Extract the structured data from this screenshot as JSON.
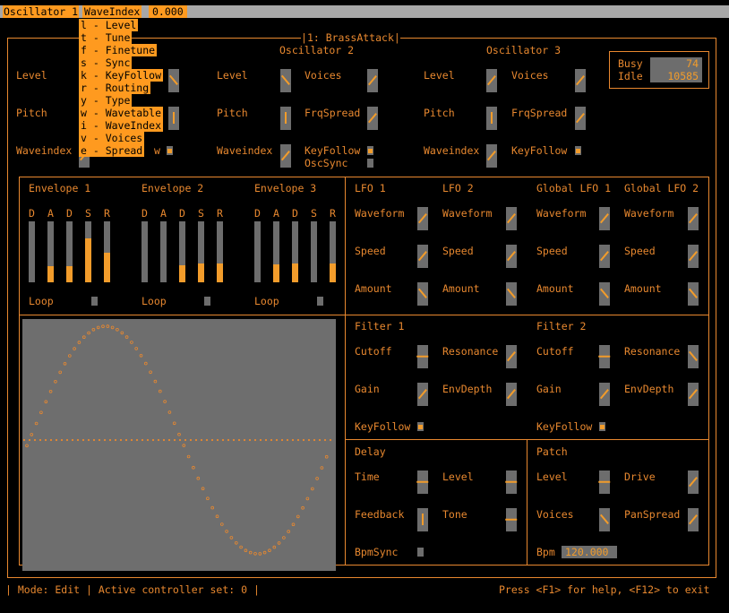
{
  "titlebar": {
    "left": "Oscillator 1",
    "active": "WaveIndex",
    "value": "0.000"
  },
  "menu": {
    "items": [
      "l - Level",
      "t - Tune",
      "f - Finetune",
      "s - Sync",
      "k - KeyFollow",
      "r - Routing",
      "y - Type",
      "w - Wavetable",
      "i - WaveIndex",
      "v - Voices",
      "e - Spread"
    ]
  },
  "patch_title": "1: BrassAttack",
  "status": {
    "busy_label": "Busy",
    "busy_value": "74",
    "idle_label": "Idle",
    "idle_value": "10585"
  },
  "osc2": {
    "title": "Oscillator 2",
    "level": "Level",
    "voices": "Voices",
    "pitch": "Pitch",
    "frqspread": "FrqSpread",
    "waveindex": "Waveindex",
    "keyfollow": "KeyFollow",
    "oscsync": "OscSync"
  },
  "osc3": {
    "title": "Oscillator 3",
    "level": "Level",
    "voices": "Voices",
    "pitch": "Pitch",
    "frqspread": "FrqSpread",
    "waveindex": "Waveindex",
    "keyfollow": "KeyFollow"
  },
  "osc1": {
    "level": "Level",
    "pitch": "Pitch",
    "waveindex": "Waveindex",
    "w_fragment": "w"
  },
  "envelopes": {
    "stages": [
      "D",
      "A",
      "D",
      "S",
      "R"
    ],
    "env1": {
      "title": "Envelope 1",
      "levels": [
        0,
        0.26,
        0.26,
        0.72,
        0.48
      ]
    },
    "env2": {
      "title": "Envelope 2",
      "levels": [
        0,
        0,
        0.28,
        0.31,
        0.31
      ]
    },
    "env3": {
      "title": "Envelope 3",
      "levels": [
        0,
        0.29,
        0.31,
        0,
        0.31
      ]
    },
    "loop": "Loop"
  },
  "lfos": {
    "lfo1": "LFO 1",
    "lfo2": "LFO 2",
    "glfo1": "Global LFO 1",
    "glfo2": "Global LFO 2",
    "waveform": "Waveform",
    "speed": "Speed",
    "amount": "Amount"
  },
  "filters": {
    "f1": "Filter 1",
    "f2": "Filter 2",
    "cutoff": "Cutoff",
    "resonance": "Resonance",
    "gain": "Gain",
    "envdepth": "EnvDepth",
    "keyfollow": "KeyFollow"
  },
  "delay": {
    "title": "Delay",
    "time": "Time",
    "level": "Level",
    "feedback": "Feedback",
    "tone": "Tone",
    "bpmsync": "BpmSync"
  },
  "patch": {
    "title": "Patch",
    "level": "Level",
    "drive": "Drive",
    "voices": "Voices",
    "panspread": "PanSpread",
    "bpm": "Bpm",
    "bpm_value": "120.000"
  },
  "footer": {
    "left": "| Mode: Edit | Active controller set: 0 |",
    "right": "Press <F1> for help, <F12> to exit"
  },
  "colors": {
    "accent": "#e8882f",
    "highlight": "#ff9a1f",
    "knob": "#6d6d6d",
    "scope_bg": "#6e6e6e"
  }
}
